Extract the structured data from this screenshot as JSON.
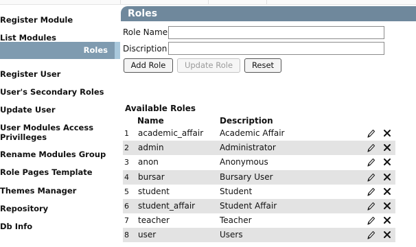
{
  "sidebar": {
    "items": [
      {
        "label": "Register Module",
        "active": false
      },
      {
        "label": "List Modules",
        "active": false
      },
      {
        "label": "Roles",
        "active": true
      },
      {
        "label": "Register User",
        "active": false
      },
      {
        "label": "User's Secondary Roles",
        "active": false
      },
      {
        "label": "Update User",
        "active": false
      },
      {
        "label": "User Modules Access Privilleges",
        "active": false
      },
      {
        "label": "Rename Modules Group",
        "active": false
      },
      {
        "label": "Role Pages Template",
        "active": false
      },
      {
        "label": "Themes Manager",
        "active": false
      },
      {
        "label": "Repository",
        "active": false
      },
      {
        "label": "Db Info",
        "active": false
      }
    ]
  },
  "panel": {
    "title": "Roles"
  },
  "form": {
    "role_name_label": "Role Name",
    "role_name_value": "",
    "description_label": "Discription",
    "description_value": "",
    "buttons": {
      "add": "Add Role",
      "update": "Update Role",
      "reset": "Reset"
    }
  },
  "table": {
    "heading": "Available Roles",
    "columns": {
      "name": "Name",
      "description": "Description"
    },
    "rows": [
      {
        "num": "1",
        "name": "academic_affair",
        "description": "Academic Affair"
      },
      {
        "num": "2",
        "name": "admin",
        "description": "Administrator"
      },
      {
        "num": "3",
        "name": "anon",
        "description": "Anonymous"
      },
      {
        "num": "4",
        "name": "bursar",
        "description": "Bursary User"
      },
      {
        "num": "5",
        "name": "student",
        "description": "Student"
      },
      {
        "num": "6",
        "name": "student_affair",
        "description": "Student Affair"
      },
      {
        "num": "7",
        "name": "teacher",
        "description": "Teacher"
      },
      {
        "num": "8",
        "name": "user",
        "description": "Users"
      }
    ],
    "row_icons": {
      "edit": "pencil-icon",
      "delete": "close-icon"
    }
  },
  "colors": {
    "header_bg": "#6f889c",
    "active_item_bg": "#7f9bb0",
    "active_item_accent": "#a9c8dc",
    "alt_row_bg": "#e3e3e3"
  }
}
